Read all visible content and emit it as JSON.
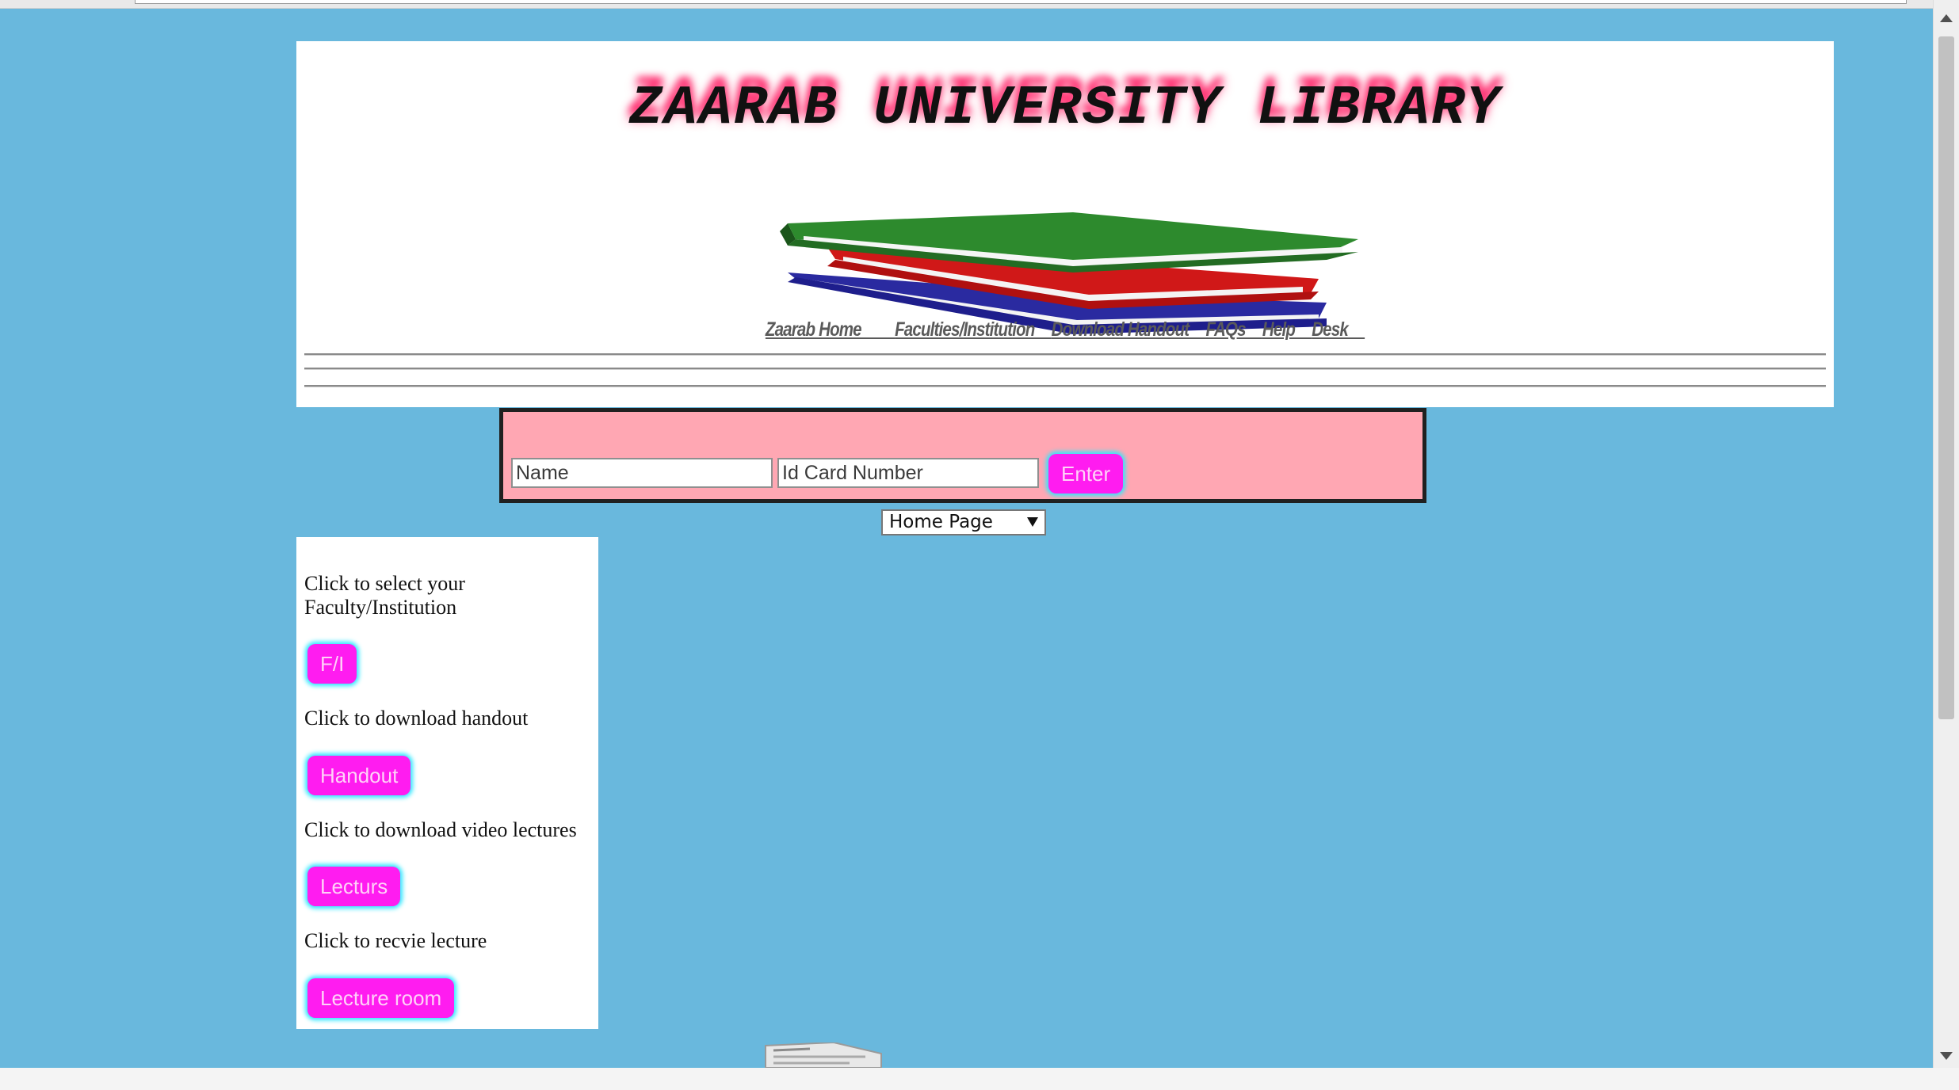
{
  "header": {
    "title": "ZAARAB UNIVERSITY LIBRARY",
    "logo_icon": "books-stack-icon",
    "nav": [
      "Zaarab Home____",
      "Faculties/Institution__",
      "Download Handout__",
      "FAQs__",
      "Help__",
      "Desk__"
    ]
  },
  "login": {
    "name_placeholder": "Name",
    "id_placeholder": "Id Card Number",
    "enter_label": "Enter"
  },
  "page_select": {
    "selected": "Home Page"
  },
  "sidebar": {
    "items": [
      {
        "text": "Click to select your Faculty/Institution",
        "button": "F/I"
      },
      {
        "text": "Click to download handout",
        "button": "Handout"
      },
      {
        "text": "Click to download video lectures",
        "button": "Lecturs"
      },
      {
        "text": "Click to recvie lecture",
        "button": "Lecture room"
      }
    ]
  },
  "colors": {
    "page_bg": "#69b8dd",
    "login_bg": "#ffa7b3",
    "button_bg": "#ff1cf0",
    "button_glow": "#2ee7ff",
    "title_glow": "#ff2a6d"
  }
}
